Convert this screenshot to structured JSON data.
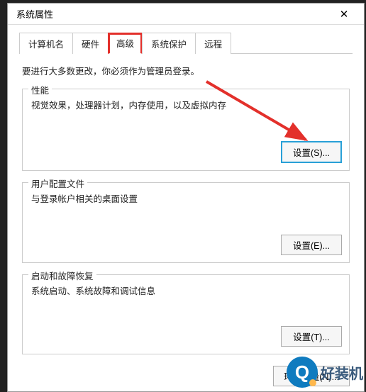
{
  "window": {
    "title": "系统属性",
    "close_label": "✕"
  },
  "tabs": {
    "items": [
      {
        "label": "计算机名"
      },
      {
        "label": "硬件"
      },
      {
        "label": "高级",
        "active": true,
        "highlighted": true
      },
      {
        "label": "系统保护"
      },
      {
        "label": "远程"
      }
    ]
  },
  "info_line": "要进行大多数更改，你必须作为管理员登录。",
  "groups": {
    "performance": {
      "legend": "性能",
      "desc": "视觉效果，处理器计划，内存使用，以及虚拟内存",
      "button": "设置(S)...",
      "highlighted": true
    },
    "user_profiles": {
      "legend": "用户配置文件",
      "desc": "与登录帐户相关的桌面设置",
      "button": "设置(E)..."
    },
    "startup_recovery": {
      "legend": "启动和故障恢复",
      "desc": "系统启动、系统故障和调试信息",
      "button": "设置(T)..."
    }
  },
  "env_button": "环境变量(N)...",
  "watermark": {
    "letter": "Q",
    "text": "好装机"
  },
  "colors": {
    "highlight_red": "#e3302b",
    "highlight_blue": "#28a0d7",
    "arrow_red": "#e3302b",
    "brand_blue": "#0f7bbf"
  }
}
